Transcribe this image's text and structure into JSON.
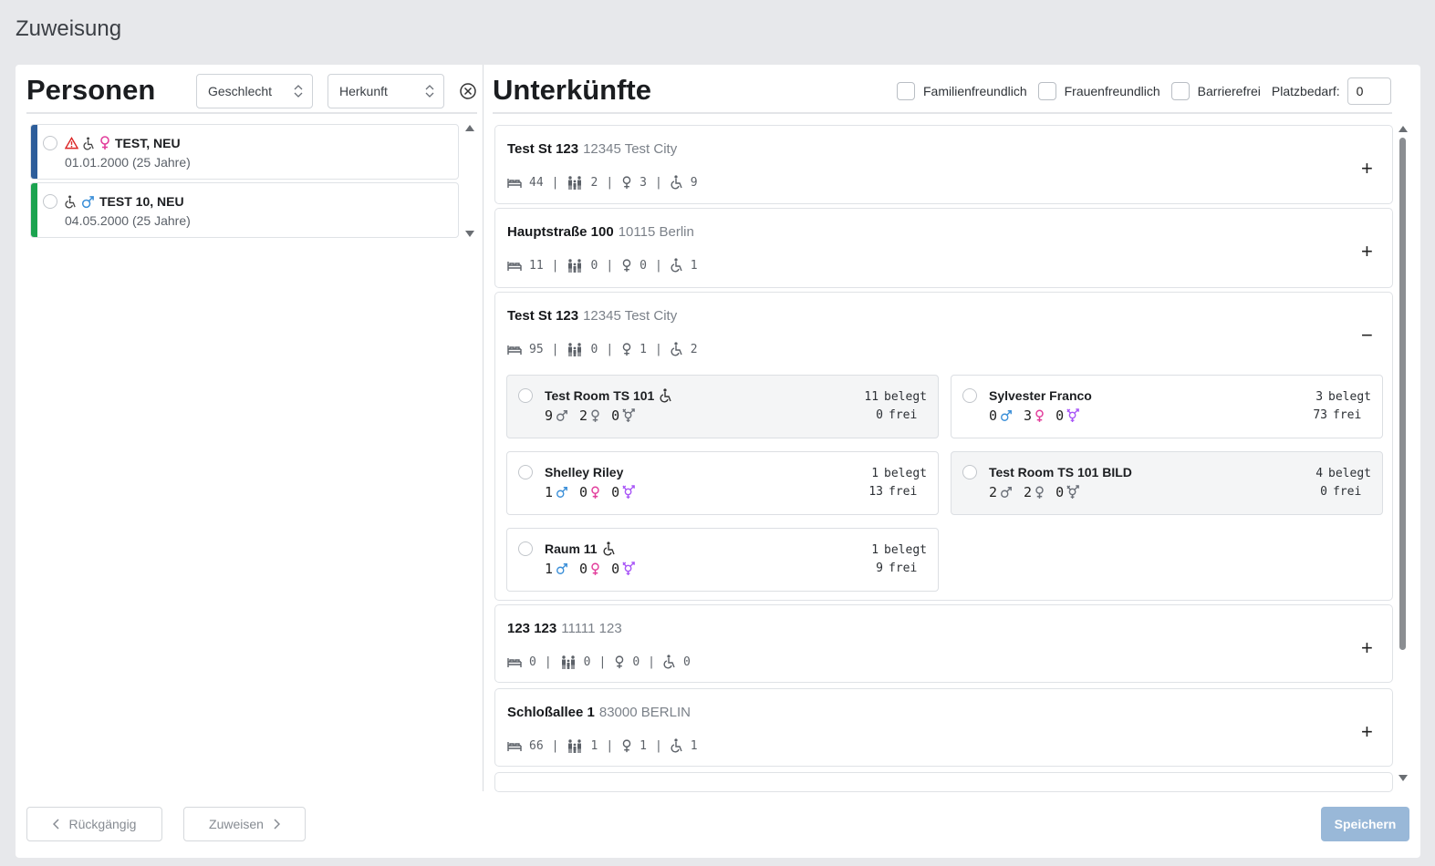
{
  "page": {
    "title": "Zuweisung"
  },
  "colors": {
    "male": "#3b8fd8",
    "female": "#e23d9b",
    "diverse": "#a855f7",
    "warning": "#dc2626",
    "bar_blue": "#2d5d9a",
    "bar_green": "#1ba34f",
    "save_button": "#99b8d8"
  },
  "left": {
    "title": "Personen",
    "filter_gender": "Geschlecht",
    "filter_origin": "Herkunft",
    "persons": [
      {
        "name": "TEST, NEU",
        "birth": "01.01.2000 (25 Jahre)",
        "icons": [
          "warning-icon",
          "wheelchair-icon",
          "female-icon"
        ]
      },
      {
        "name": "TEST 10, NEU",
        "birth": "04.05.2000 (25 Jahre)",
        "icons": [
          "wheelchair-icon",
          "male-icon"
        ]
      }
    ]
  },
  "right": {
    "title": "Unterkünfte",
    "filters": {
      "family": "Familienfreundlich",
      "women": "Frauenfreundlich",
      "barrierfree": "Barrierefrei",
      "demand_label": "Platzbedarf:",
      "demand_value": "0"
    },
    "accommodations": [
      {
        "street": "Test St 123",
        "city": "12345 Test City",
        "beds": "44",
        "family": "2",
        "women": "3",
        "access": "9",
        "toggle": "+"
      },
      {
        "street": "Hauptstraße 100",
        "city": "10115 Berlin",
        "beds": "11",
        "family": "0",
        "women": "0",
        "access": "1",
        "toggle": "+"
      },
      {
        "street": "Test St 123",
        "city": "12345 Test City",
        "beds": "95",
        "family": "0",
        "women": "1",
        "access": "2",
        "toggle": "−",
        "rooms": [
          {
            "name": "Test Room TS 101",
            "accessible": true,
            "m": "9",
            "f": "2",
            "d": "0",
            "occupied": "11",
            "free": "0",
            "gendered": false
          },
          {
            "name": "Sylvester Franco",
            "accessible": false,
            "m": "0",
            "f": "3",
            "d": "0",
            "occupied": "3",
            "free": "73",
            "gendered": true
          },
          {
            "name": "Shelley Riley",
            "accessible": false,
            "m": "1",
            "f": "0",
            "d": "0",
            "occupied": "1",
            "free": "13",
            "gendered": true
          },
          {
            "name": "Test Room TS 101 BILD",
            "accessible": false,
            "m": "2",
            "f": "2",
            "d": "0",
            "occupied": "4",
            "free": "0",
            "gendered": false
          },
          {
            "name": "Raum 11",
            "accessible": true,
            "m": "1",
            "f": "0",
            "d": "0",
            "occupied": "1",
            "free": "9",
            "gendered": true
          }
        ]
      },
      {
        "street": "123 123",
        "city": "11111 123",
        "beds": "0",
        "family": "0",
        "women": "0",
        "access": "0",
        "toggle": "+"
      },
      {
        "street": "Schloßallee 1",
        "city": "83000 BERLIN",
        "beds": "66",
        "family": "1",
        "women": "1",
        "access": "1",
        "toggle": "+"
      }
    ],
    "occupied_label": "belegt",
    "free_label": "frei"
  },
  "footer": {
    "undo": "Rückgängig",
    "assign": "Zuweisen",
    "save": "Speichern"
  }
}
